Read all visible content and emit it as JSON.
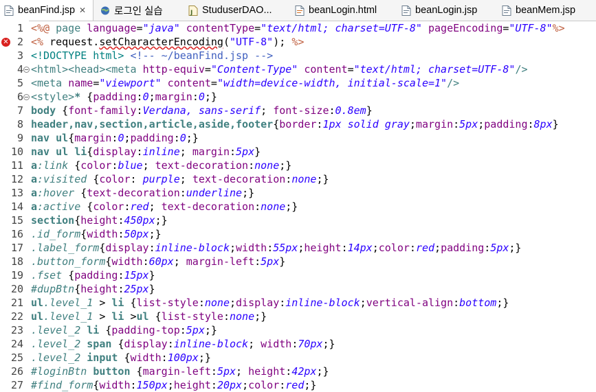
{
  "tabs": [
    {
      "label": "beanFind.jsp",
      "icon": "jsp-file-icon",
      "active": true,
      "close": "✕"
    },
    {
      "label": "로그인 실습",
      "icon": "globe-icon",
      "active": false
    },
    {
      "label": "StuduserDAO...",
      "icon": "java-class-icon",
      "active": false
    },
    {
      "label": "beanLogin.html",
      "icon": "html-file-icon",
      "active": false
    },
    {
      "label": "beanLogin.jsp",
      "icon": "jsp-file-icon",
      "active": false
    },
    {
      "label": "beanMem.jsp",
      "icon": "jsp-file-icon",
      "active": false
    }
  ],
  "lines": [
    {
      "n": "1",
      "fold": false,
      "err": false,
      "segs": [
        [
          "directive",
          "<%@ "
        ],
        [
          "tag",
          "page "
        ],
        [
          "attr",
          "language"
        ],
        [
          "punct",
          "="
        ],
        [
          "str",
          "\"java\""
        ],
        [
          "attr",
          " contentType"
        ],
        [
          "punct",
          "="
        ],
        [
          "str",
          "\"text/html; charset=UTF-8\""
        ],
        [
          "attr",
          " pageEncoding"
        ],
        [
          "punct",
          "="
        ],
        [
          "str",
          "\"UTF-8\""
        ],
        [
          "directive",
          "%>"
        ]
      ]
    },
    {
      "n": "2",
      "fold": false,
      "err": true,
      "segs": [
        [
          "directive",
          "<% "
        ],
        [
          "java",
          "request."
        ],
        [
          "squig",
          "setCharacterEncoding"
        ],
        [
          "java",
          "("
        ],
        [
          "jstr",
          "\"UTF-8\""
        ],
        [
          "java",
          "); "
        ],
        [
          "directive",
          "%>"
        ]
      ]
    },
    {
      "n": "3",
      "fold": false,
      "err": false,
      "segs": [
        [
          "doctype",
          "<!DOCTYPE html> "
        ],
        [
          "comment",
          "<!-- ~/beanFind.jsp -->"
        ]
      ]
    },
    {
      "n": "4",
      "fold": true,
      "err": false,
      "segs": [
        [
          "tag",
          "<html><head><meta "
        ],
        [
          "attr",
          "http-equiv"
        ],
        [
          "punct",
          "="
        ],
        [
          "str",
          "\"Content-Type\""
        ],
        [
          "attr",
          " content"
        ],
        [
          "punct",
          "="
        ],
        [
          "str",
          "\"text/html; charset=UTF-8\""
        ],
        [
          "tag",
          "/>"
        ]
      ]
    },
    {
      "n": "5",
      "fold": false,
      "err": false,
      "segs": [
        [
          "tag",
          "<meta "
        ],
        [
          "attr",
          "name"
        ],
        [
          "punct",
          "="
        ],
        [
          "str",
          "\"viewport\""
        ],
        [
          "attr",
          " content"
        ],
        [
          "punct",
          "="
        ],
        [
          "str",
          "\"width=device-width, initial-scale=1\""
        ],
        [
          "tag",
          "/>"
        ]
      ]
    },
    {
      "n": "6",
      "fold": true,
      "err": false,
      "segs": [
        [
          "tag",
          "<style>"
        ],
        [
          "sel",
          "* "
        ],
        [
          "punct",
          "{"
        ],
        [
          "prop",
          "padding"
        ],
        [
          "punct",
          ":"
        ],
        [
          "val",
          "0"
        ],
        [
          "punct",
          ";"
        ],
        [
          "prop",
          "margin"
        ],
        [
          "punct",
          ":"
        ],
        [
          "val",
          "0"
        ],
        [
          "punct",
          ";}"
        ]
      ]
    },
    {
      "n": "7",
      "fold": false,
      "err": false,
      "segs": [
        [
          "sel",
          "body "
        ],
        [
          "punct",
          "{"
        ],
        [
          "prop",
          "font-family"
        ],
        [
          "punct",
          ":"
        ],
        [
          "val",
          "Verdana, sans-serif"
        ],
        [
          "punct",
          "; "
        ],
        [
          "prop",
          "font-size"
        ],
        [
          "punct",
          ":"
        ],
        [
          "val",
          "0.8em"
        ],
        [
          "punct",
          "}"
        ]
      ]
    },
    {
      "n": "8",
      "fold": false,
      "err": false,
      "segs": [
        [
          "sel",
          "header,nav,section,article,aside,footer"
        ],
        [
          "punct",
          "{"
        ],
        [
          "prop",
          "border"
        ],
        [
          "punct",
          ":"
        ],
        [
          "val",
          "1px solid gray"
        ],
        [
          "punct",
          ";"
        ],
        [
          "prop",
          "margin"
        ],
        [
          "punct",
          ":"
        ],
        [
          "val",
          "5px"
        ],
        [
          "punct",
          ";"
        ],
        [
          "prop",
          "padding"
        ],
        [
          "punct",
          ":"
        ],
        [
          "val",
          "8px"
        ],
        [
          "punct",
          "}"
        ]
      ]
    },
    {
      "n": "9",
      "fold": false,
      "err": false,
      "segs": [
        [
          "sel",
          "nav ul"
        ],
        [
          "punct",
          "{"
        ],
        [
          "prop",
          "margin"
        ],
        [
          "punct",
          ":"
        ],
        [
          "val",
          "0"
        ],
        [
          "punct",
          ";"
        ],
        [
          "prop",
          "padding"
        ],
        [
          "punct",
          ":"
        ],
        [
          "val",
          "0"
        ],
        [
          "punct",
          ";}"
        ]
      ]
    },
    {
      "n": "10",
      "fold": false,
      "err": false,
      "segs": [
        [
          "sel",
          "nav ul li"
        ],
        [
          "punct",
          "{"
        ],
        [
          "prop",
          "display"
        ],
        [
          "punct",
          ":"
        ],
        [
          "val",
          "inline"
        ],
        [
          "punct",
          "; "
        ],
        [
          "prop",
          "margin"
        ],
        [
          "punct",
          ":"
        ],
        [
          "val",
          "5px"
        ],
        [
          "punct",
          "}"
        ]
      ]
    },
    {
      "n": "11",
      "fold": false,
      "err": false,
      "segs": [
        [
          "sel",
          "a"
        ],
        [
          "pseudo",
          ":link "
        ],
        [
          "punct",
          "{"
        ],
        [
          "prop",
          "color"
        ],
        [
          "punct",
          ":"
        ],
        [
          "val",
          "blue"
        ],
        [
          "punct",
          "; "
        ],
        [
          "prop",
          "text-decoration"
        ],
        [
          "punct",
          ":"
        ],
        [
          "val",
          "none"
        ],
        [
          "punct",
          ";}"
        ]
      ]
    },
    {
      "n": "12",
      "fold": false,
      "err": false,
      "segs": [
        [
          "sel",
          "a"
        ],
        [
          "pseudo",
          ":visited "
        ],
        [
          "punct",
          "{"
        ],
        [
          "prop",
          "color"
        ],
        [
          "punct",
          ": "
        ],
        [
          "val",
          "purple"
        ],
        [
          "punct",
          "; "
        ],
        [
          "prop",
          "text-decoration"
        ],
        [
          "punct",
          ":"
        ],
        [
          "val",
          "none"
        ],
        [
          "punct",
          ";}"
        ]
      ]
    },
    {
      "n": "13",
      "fold": false,
      "err": false,
      "segs": [
        [
          "sel",
          "a"
        ],
        [
          "pseudo",
          ":hover "
        ],
        [
          "punct",
          "{"
        ],
        [
          "prop",
          "text-decoration"
        ],
        [
          "punct",
          ":"
        ],
        [
          "val",
          "underline"
        ],
        [
          "punct",
          ";}"
        ]
      ]
    },
    {
      "n": "14",
      "fold": false,
      "err": false,
      "segs": [
        [
          "sel",
          "a"
        ],
        [
          "pseudo",
          ":active "
        ],
        [
          "punct",
          "{"
        ],
        [
          "prop",
          "color"
        ],
        [
          "punct",
          ":"
        ],
        [
          "val",
          "red"
        ],
        [
          "punct",
          "; "
        ],
        [
          "prop",
          "text-decoration"
        ],
        [
          "punct",
          ":"
        ],
        [
          "val",
          "none"
        ],
        [
          "punct",
          ";}"
        ]
      ]
    },
    {
      "n": "15",
      "fold": false,
      "err": false,
      "segs": [
        [
          "sel",
          "section"
        ],
        [
          "punct",
          "{"
        ],
        [
          "prop",
          "height"
        ],
        [
          "punct",
          ":"
        ],
        [
          "val",
          "450px"
        ],
        [
          "punct",
          ";}"
        ]
      ]
    },
    {
      "n": "16",
      "fold": false,
      "err": false,
      "segs": [
        [
          "pseudo",
          ".id_form"
        ],
        [
          "punct",
          "{"
        ],
        [
          "prop",
          "width"
        ],
        [
          "punct",
          ":"
        ],
        [
          "val",
          "50px"
        ],
        [
          "punct",
          ";}"
        ]
      ]
    },
    {
      "n": "17",
      "fold": false,
      "err": false,
      "segs": [
        [
          "pseudo",
          ".label_form"
        ],
        [
          "punct",
          "{"
        ],
        [
          "prop",
          "display"
        ],
        [
          "punct",
          ":"
        ],
        [
          "val",
          "inline-block"
        ],
        [
          "punct",
          ";"
        ],
        [
          "prop",
          "width"
        ],
        [
          "punct",
          ":"
        ],
        [
          "val",
          "55px"
        ],
        [
          "punct",
          ";"
        ],
        [
          "prop",
          "height"
        ],
        [
          "punct",
          ":"
        ],
        [
          "val",
          "14px"
        ],
        [
          "punct",
          ";"
        ],
        [
          "prop",
          "color"
        ],
        [
          "punct",
          ":"
        ],
        [
          "val",
          "red"
        ],
        [
          "punct",
          ";"
        ],
        [
          "prop",
          "padding"
        ],
        [
          "punct",
          ":"
        ],
        [
          "val",
          "5px"
        ],
        [
          "punct",
          ";}"
        ]
      ]
    },
    {
      "n": "18",
      "fold": false,
      "err": false,
      "segs": [
        [
          "pseudo",
          ".button_form"
        ],
        [
          "punct",
          "{"
        ],
        [
          "prop",
          "width"
        ],
        [
          "punct",
          ":"
        ],
        [
          "val",
          "60px"
        ],
        [
          "punct",
          "; "
        ],
        [
          "prop",
          "margin-left"
        ],
        [
          "punct",
          ":"
        ],
        [
          "val",
          "5px"
        ],
        [
          "punct",
          "}"
        ]
      ]
    },
    {
      "n": "19",
      "fold": false,
      "err": false,
      "segs": [
        [
          "pseudo",
          ".fset "
        ],
        [
          "punct",
          "{"
        ],
        [
          "prop",
          "padding"
        ],
        [
          "punct",
          ":"
        ],
        [
          "val",
          "15px"
        ],
        [
          "punct",
          "}"
        ]
      ]
    },
    {
      "n": "20",
      "fold": false,
      "err": false,
      "segs": [
        [
          "pseudo",
          "#dupBtn"
        ],
        [
          "punct",
          "{"
        ],
        [
          "prop",
          "height"
        ],
        [
          "punct",
          ":"
        ],
        [
          "val",
          "25px"
        ],
        [
          "punct",
          "}"
        ]
      ]
    },
    {
      "n": "21",
      "fold": false,
      "err": false,
      "segs": [
        [
          "sel",
          "ul"
        ],
        [
          "pseudo",
          ".level_1"
        ],
        [
          "punct",
          " > "
        ],
        [
          "sel",
          "li "
        ],
        [
          "punct",
          "{"
        ],
        [
          "prop",
          "list-style"
        ],
        [
          "punct",
          ":"
        ],
        [
          "val",
          "none"
        ],
        [
          "punct",
          ";"
        ],
        [
          "prop",
          "display"
        ],
        [
          "punct",
          ":"
        ],
        [
          "val",
          "inline-block"
        ],
        [
          "punct",
          ";"
        ],
        [
          "prop",
          "vertical-align"
        ],
        [
          "punct",
          ":"
        ],
        [
          "val",
          "bottom"
        ],
        [
          "punct",
          ";}"
        ]
      ]
    },
    {
      "n": "22",
      "fold": false,
      "err": false,
      "segs": [
        [
          "sel",
          "ul"
        ],
        [
          "pseudo",
          ".level_1"
        ],
        [
          "punct",
          " > "
        ],
        [
          "sel",
          "li "
        ],
        [
          "punct",
          ">"
        ],
        [
          "sel",
          "ul "
        ],
        [
          "punct",
          "{"
        ],
        [
          "prop",
          "list-style"
        ],
        [
          "punct",
          ":"
        ],
        [
          "val",
          "none"
        ],
        [
          "punct",
          ";}"
        ]
      ]
    },
    {
      "n": "23",
      "fold": false,
      "err": false,
      "segs": [
        [
          "pseudo",
          ".level_2 "
        ],
        [
          "sel",
          "li "
        ],
        [
          "punct",
          "{"
        ],
        [
          "prop",
          "padding-top"
        ],
        [
          "punct",
          ":"
        ],
        [
          "val",
          "5px"
        ],
        [
          "punct",
          ";}"
        ]
      ]
    },
    {
      "n": "24",
      "fold": false,
      "err": false,
      "segs": [
        [
          "pseudo",
          ".level_2 "
        ],
        [
          "sel",
          "span "
        ],
        [
          "punct",
          "{"
        ],
        [
          "prop",
          "display"
        ],
        [
          "punct",
          ":"
        ],
        [
          "val",
          "inline-block"
        ],
        [
          "punct",
          "; "
        ],
        [
          "prop",
          "width"
        ],
        [
          "punct",
          ":"
        ],
        [
          "val",
          "70px"
        ],
        [
          "punct",
          ";}"
        ]
      ]
    },
    {
      "n": "25",
      "fold": false,
      "err": false,
      "segs": [
        [
          "pseudo",
          ".level_2 "
        ],
        [
          "sel",
          "input "
        ],
        [
          "punct",
          "{"
        ],
        [
          "prop",
          "width"
        ],
        [
          "punct",
          ":"
        ],
        [
          "val",
          "100px"
        ],
        [
          "punct",
          ";}"
        ]
      ]
    },
    {
      "n": "26",
      "fold": false,
      "err": false,
      "segs": [
        [
          "pseudo",
          "#loginBtn "
        ],
        [
          "sel",
          "button "
        ],
        [
          "punct",
          "{"
        ],
        [
          "prop",
          "margin-left"
        ],
        [
          "punct",
          ":"
        ],
        [
          "val",
          "5px"
        ],
        [
          "punct",
          "; "
        ],
        [
          "prop",
          "height"
        ],
        [
          "punct",
          ":"
        ],
        [
          "val",
          "42px"
        ],
        [
          "punct",
          ";}"
        ]
      ]
    },
    {
      "n": "27",
      "fold": false,
      "err": false,
      "segs": [
        [
          "pseudo",
          "#find_form"
        ],
        [
          "punct",
          "{"
        ],
        [
          "prop",
          "width"
        ],
        [
          "punct",
          ":"
        ],
        [
          "val",
          "150px"
        ],
        [
          "punct",
          ";"
        ],
        [
          "prop",
          "height"
        ],
        [
          "punct",
          ":"
        ],
        [
          "val",
          "20px"
        ],
        [
          "punct",
          ";"
        ],
        [
          "prop",
          "color"
        ],
        [
          "punct",
          ":"
        ],
        [
          "val",
          "red"
        ],
        [
          "punct",
          ";}"
        ]
      ]
    }
  ]
}
